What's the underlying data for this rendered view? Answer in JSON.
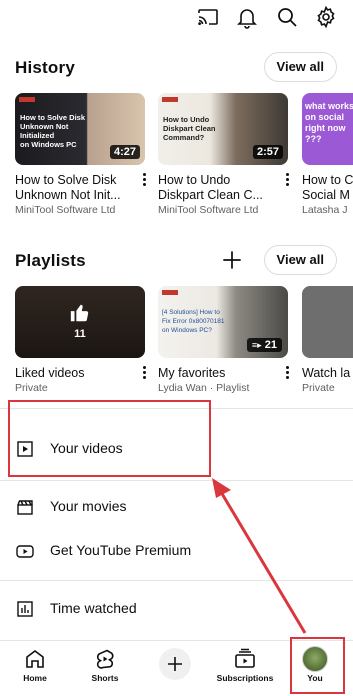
{
  "colors": {
    "accent_red": "#d9363e",
    "text": "#0f0f0f",
    "secondary": "#606060"
  },
  "topbar": {
    "icons": [
      "cast-icon",
      "bell-icon",
      "search-icon",
      "settings-icon"
    ]
  },
  "history": {
    "title": "History",
    "view_all": "View all",
    "videos": [
      {
        "title": "How to Solve Disk\nUnknown Not Init...",
        "channel": "MiniTool Software Ltd",
        "duration": "4:27",
        "thumb_text": "How to Solve Disk\nUnknown Not\nInitialized\non Windows PC"
      },
      {
        "title": "How to Undo\nDiskpart Clean C...",
        "channel": "MiniTool Software Ltd",
        "duration": "2:57",
        "thumb_text": "How to Undo\nDiskpart Clean\nCommand?"
      },
      {
        "title": "How to C\nSocial M",
        "channel": "Latasha J",
        "duration": "",
        "thumb_text": "what works\non social\nright now\n???"
      }
    ]
  },
  "playlists": {
    "title": "Playlists",
    "view_all": "View all",
    "items": [
      {
        "title": "Liked videos",
        "subtitle": "Private",
        "count": "11"
      },
      {
        "title": "My favorites",
        "subtitle": "Lydia Wan · Playlist",
        "count": "21",
        "thumb_text": "[4 Solutions] How to\nFix Error 0x80070181\non Windows PC?"
      },
      {
        "title": "Watch la",
        "subtitle": "Private",
        "count": ""
      }
    ]
  },
  "menu": {
    "your_videos": "Your videos",
    "your_movies": "Your movies",
    "premium": "Get YouTube Premium",
    "time_watched": "Time watched"
  },
  "bottom_nav": {
    "home": "Home",
    "shorts": "Shorts",
    "subscriptions": "Subscriptions",
    "you": "You"
  }
}
